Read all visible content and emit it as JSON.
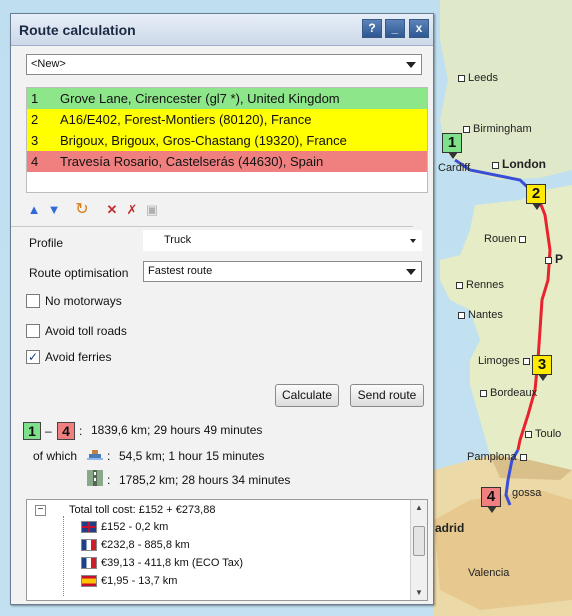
{
  "window": {
    "title": "Route calculation",
    "help_label": "?",
    "minimize_label": "_",
    "close_label": "x"
  },
  "route_select": {
    "value": "<New>"
  },
  "waypoints": [
    {
      "num": "1",
      "label": "Grove Lane, Cirencester (gl7 *), United Kingdom",
      "color": "#8ee68a"
    },
    {
      "num": "2",
      "label": "A16/E402, Forest-Montiers (80120), France",
      "color": "#ffff00"
    },
    {
      "num": "3",
      "label": "Brigoux, Brigoux, Gros-Chastang (19320), France",
      "color": "#ffff00"
    },
    {
      "num": "4",
      "label": "Travesía Rosario, Castelserás (44630), Spain",
      "color": "#f08080"
    }
  ],
  "toolbar": {
    "icons": [
      "arrow-up-icon",
      "arrow-down-icon",
      "reverse-icon",
      "delete-icon",
      "delete-all-icon",
      "copy-icon"
    ]
  },
  "profile": {
    "label": "Profile",
    "value": "Truck"
  },
  "optimisation": {
    "label": "Route optimisation",
    "value": "Fastest route"
  },
  "options": {
    "no_motorways": {
      "label": "No motorways",
      "checked": false
    },
    "avoid_toll": {
      "label": "Avoid toll roads",
      "checked": false
    },
    "avoid_ferries": {
      "label": "Avoid ferries",
      "checked": true,
      "mark": "✓"
    }
  },
  "buttons": {
    "calculate": "Calculate",
    "send_route": "Send route"
  },
  "summary": {
    "from": "1",
    "to": "4",
    "dash": "–",
    "colon": ":",
    "total": "1839,6 km; 29 hours 49 minutes",
    "of_which": "of which",
    "ferry": "54,5 km; 1 hour 15 minutes",
    "road": "1785,2 km; 28 hours 34 minutes"
  },
  "tolls": {
    "collapse": "−",
    "total": "Total toll cost: £152 + €273,88",
    "rows": [
      {
        "flag": "uk",
        "text": "£152 - 0,2 km"
      },
      {
        "flag": "fr",
        "text": "€232,8 - 885,8 km"
      },
      {
        "flag": "fr",
        "text": "€39,13 - 411,8 km (ECO Tax)"
      },
      {
        "flag": "es",
        "text": "€1,95 - 13,7 km"
      }
    ]
  },
  "map": {
    "cities": [
      {
        "name": "Leeds",
        "bold": false
      },
      {
        "name": "Birmingham",
        "bold": false
      },
      {
        "name": "London",
        "bold": true
      },
      {
        "name": "Cardiff",
        "bold": false
      },
      {
        "name": "Rouen",
        "bold": false
      },
      {
        "name": "Rennes",
        "bold": false
      },
      {
        "name": "Nantes",
        "bold": false
      },
      {
        "name": "Limoges",
        "bold": false
      },
      {
        "name": "Bordeaux",
        "bold": false
      },
      {
        "name": "Toulo",
        "bold": false
      },
      {
        "name": "Pamplona",
        "bold": false
      },
      {
        "name": "gossa",
        "bold": false
      },
      {
        "name": "adrid",
        "bold": true
      },
      {
        "name": "Valencia",
        "bold": false
      },
      {
        "name": "P",
        "bold": true
      }
    ],
    "markers": [
      "1",
      "2",
      "3",
      "4"
    ],
    "route_colors": {
      "motorway": "#e8232d",
      "other": "#3a4fd8"
    }
  }
}
